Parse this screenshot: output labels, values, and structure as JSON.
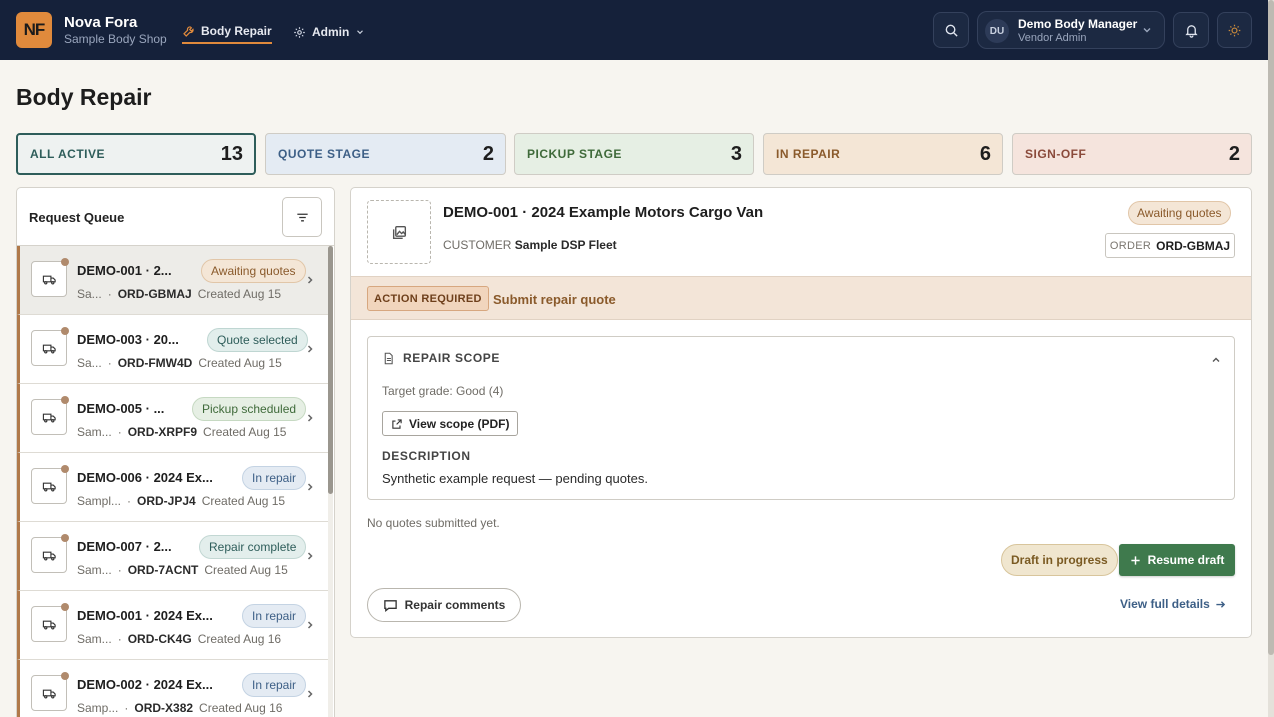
{
  "app": {
    "logo": "NF",
    "name": "Nova Fora",
    "subtitle": "Sample Body Shop"
  },
  "nav": [
    {
      "label": "Body Repair",
      "icon": "wrench-icon",
      "active": true
    },
    {
      "label": "Admin",
      "icon": "gear-icon",
      "active": false
    }
  ],
  "user": {
    "initials": "DU",
    "name": "Demo Body Manager",
    "role": "Vendor Admin"
  },
  "page_title": "Body Repair",
  "stats": [
    {
      "label": "ALL ACTIVE",
      "count": "13",
      "color": "#2e5d5a",
      "bg": "#eef2f1"
    },
    {
      "label": "QUOTE STAGE",
      "count": "2",
      "color": "#3d5f86",
      "bg": "#e4ebf3"
    },
    {
      "label": "PICKUP STAGE",
      "count": "3",
      "color": "#3f6a3a",
      "bg": "#e6efe4"
    },
    {
      "label": "IN REPAIR",
      "count": "6",
      "color": "#8a5a2b",
      "bg": "#f4e6d6"
    },
    {
      "label": "SIGN-OFF",
      "count": "2",
      "color": "#8a4a3b",
      "bg": "#f5e4dd"
    }
  ],
  "queue": {
    "title": "Request Queue",
    "rows": [
      {
        "title": "DEMO-001 · 2...",
        "badge": "Awaiting quotes",
        "badge_class": "b-await",
        "customer": "Sa...",
        "order": "ORD-GBMAJ",
        "created": "Created Aug 15",
        "selected": true
      },
      {
        "title": "DEMO-003 · 20...",
        "badge": "Quote selected",
        "badge_class": "b-quote",
        "customer": "Sa...",
        "order": "ORD-FMW4D",
        "created": "Created Aug 15",
        "selected": false
      },
      {
        "title": "DEMO-005 · ...",
        "badge": "Pickup scheduled",
        "badge_class": "b-pickup",
        "customer": "Sam...",
        "order": "ORD-XRPF9",
        "created": "Created Aug 15",
        "selected": false
      },
      {
        "title": "DEMO-006 · 2024 Ex...",
        "badge": "In repair",
        "badge_class": "b-repair",
        "customer": "Sampl...",
        "order": "ORD-JPJ4",
        "created": "Created Aug 15",
        "selected": false
      },
      {
        "title": "DEMO-007 · 2...",
        "badge": "Repair complete",
        "badge_class": "b-complete",
        "customer": "Sam...",
        "order": "ORD-7ACNT",
        "created": "Created Aug 15",
        "selected": false
      },
      {
        "title": "DEMO-001 · 2024 Ex...",
        "badge": "In repair",
        "badge_class": "b-repair",
        "customer": "Sam...",
        "order": "ORD-CK4G",
        "created": "Created Aug 16",
        "selected": false
      },
      {
        "title": "DEMO-002 · 2024 Ex...",
        "badge": "In repair",
        "badge_class": "b-repair",
        "customer": "Samp...",
        "order": "ORD-X382",
        "created": "Created Aug 16",
        "selected": false
      }
    ]
  },
  "detail": {
    "title": "DEMO-001 · 2024 Example Motors Cargo Van",
    "customer_label": "CUSTOMER",
    "customer": "Sample DSP Fleet",
    "status": "Awaiting quotes",
    "order_label": "ORDER",
    "order": "ORD-GBMAJ",
    "action_tag": "ACTION REQUIRED",
    "action_text": "Submit repair quote",
    "scope": {
      "heading": "REPAIR SCOPE",
      "grade": "Target grade: Good (4)",
      "view_button": "View scope (PDF)",
      "description_heading": "DESCRIPTION",
      "description": "Synthetic example request — pending quotes."
    },
    "no_quotes": "No quotes submitted yet.",
    "draft_badge": "Draft in progress",
    "resume_button": "Resume draft",
    "comments_button": "Repair comments",
    "full_details_link": "View full details"
  }
}
